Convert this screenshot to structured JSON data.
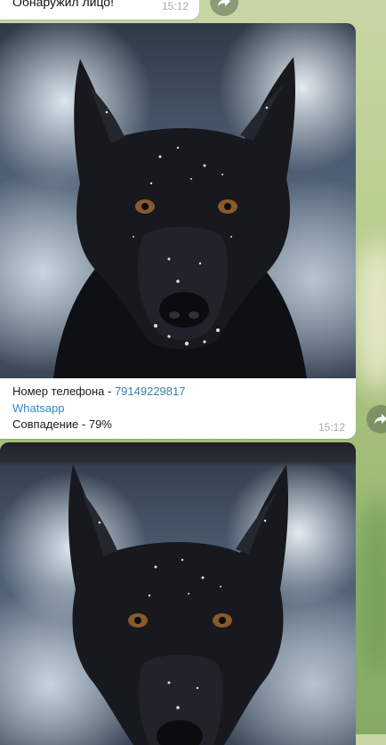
{
  "messages": [
    {
      "text": "Обнаружил лицо!",
      "time": "15:12"
    },
    {
      "photo_alt_icon": "dog-photo",
      "caption": {
        "phone_label": "Номер телефона - ",
        "phone_number": "79149229817",
        "whatsapp_link": "Whatsapp",
        "match_line": "Совпадение - 79%"
      },
      "time": "15:12"
    },
    {
      "photo_alt_icon": "dog-photo"
    }
  ],
  "colors": {
    "bubble": "#ffffff",
    "link": "#2e8ac9",
    "phone": "#3a7fae",
    "time": "#a3aeb7",
    "background": "#b9cf8f"
  },
  "icons": {
    "share": "share-arrow-icon"
  }
}
